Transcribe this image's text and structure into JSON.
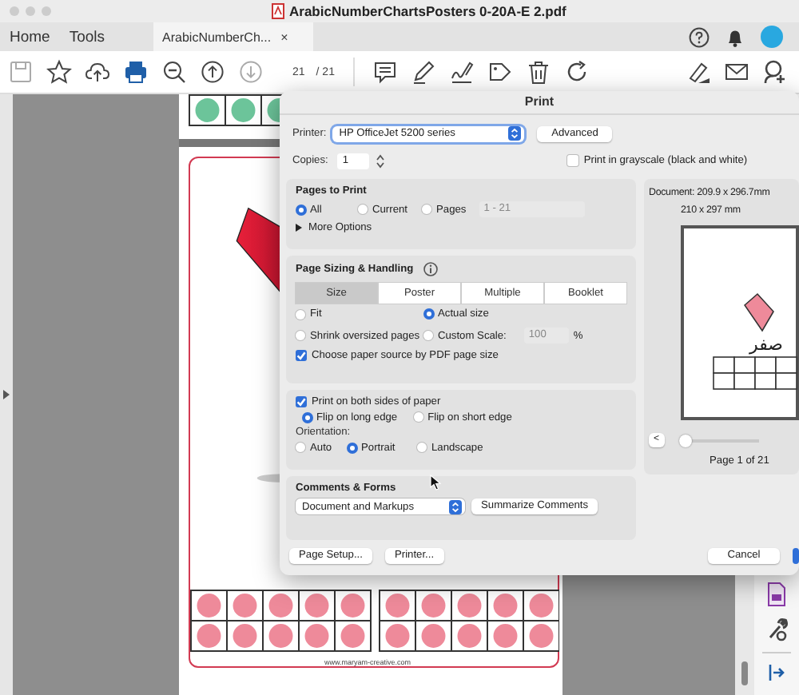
{
  "window": {
    "title": "ArabicNumberChartsPosters 0-20A-E 2.pdf"
  },
  "tabs": [
    {
      "label": "Home",
      "selected": false,
      "kind": "nav"
    },
    {
      "label": "Tools",
      "selected": false,
      "kind": "nav"
    },
    {
      "label": "ArabicNumberCh...",
      "selected": true,
      "kind": "document",
      "close": "×"
    }
  ],
  "toolbar": {
    "page_number": "21",
    "page_count": "/ 21"
  },
  "document": {
    "footer": "www.maryam-creative.com"
  },
  "print_dialog": {
    "title": "Print",
    "printer": {
      "label": "Printer:",
      "value": "HP OfficeJet 5200 series"
    },
    "advanced": "Advanced",
    "copies": {
      "label": "Copies:",
      "value": "1"
    },
    "grayscale": {
      "label": "Print in grayscale (black and white)",
      "checked": false
    },
    "pages_to_print": {
      "heading": "Pages to Print",
      "options": [
        {
          "label": "All",
          "selected": true
        },
        {
          "label": "Current",
          "selected": false
        },
        {
          "label": "Pages",
          "selected": false
        }
      ],
      "range": "1 - 21",
      "more_options": "More Options"
    },
    "page_sizing": {
      "heading": "Page Sizing & Handling",
      "modes": [
        {
          "label": "Size",
          "selected": true
        },
        {
          "label": "Poster",
          "selected": false
        },
        {
          "label": "Multiple",
          "selected": false
        },
        {
          "label": "Booklet",
          "selected": false
        }
      ],
      "scale_options": [
        {
          "label": "Fit",
          "selected": false,
          "kind": "radio"
        },
        {
          "label": "Actual size",
          "selected": true,
          "kind": "radio"
        },
        {
          "label": "Shrink oversized pages",
          "selected": false,
          "kind": "radio"
        },
        {
          "label": "Custom Scale:",
          "selected": false,
          "kind": "scale",
          "value": "100",
          "unit": "%"
        }
      ],
      "paper_source": {
        "label": "Choose paper source by PDF page size",
        "checked": true
      }
    },
    "duplex": {
      "label": "Print on both sides of paper",
      "checked": true,
      "options": [
        {
          "label": "Flip on long edge",
          "selected": true
        },
        {
          "label": "Flip on short edge",
          "selected": false
        }
      ]
    },
    "orientation": {
      "label": "Orientation:",
      "options": [
        {
          "label": "Auto",
          "selected": false
        },
        {
          "label": "Portrait",
          "selected": true
        },
        {
          "label": "Landscape",
          "selected": false
        }
      ]
    },
    "comments": {
      "heading": "Comments & Forms",
      "select": "Document and Markups",
      "button": "Summarize Comments"
    },
    "preview": {
      "document_size": "Document: 209.9 x 296.7mm",
      "paper_size": "210 x 297 mm",
      "page_word": "صفر",
      "prev": "<",
      "level": 0,
      "page_label": "Page 1 of 21"
    },
    "buttons": {
      "page_setup": "Page Setup...",
      "printer": "Printer...",
      "cancel": "Cancel"
    }
  }
}
